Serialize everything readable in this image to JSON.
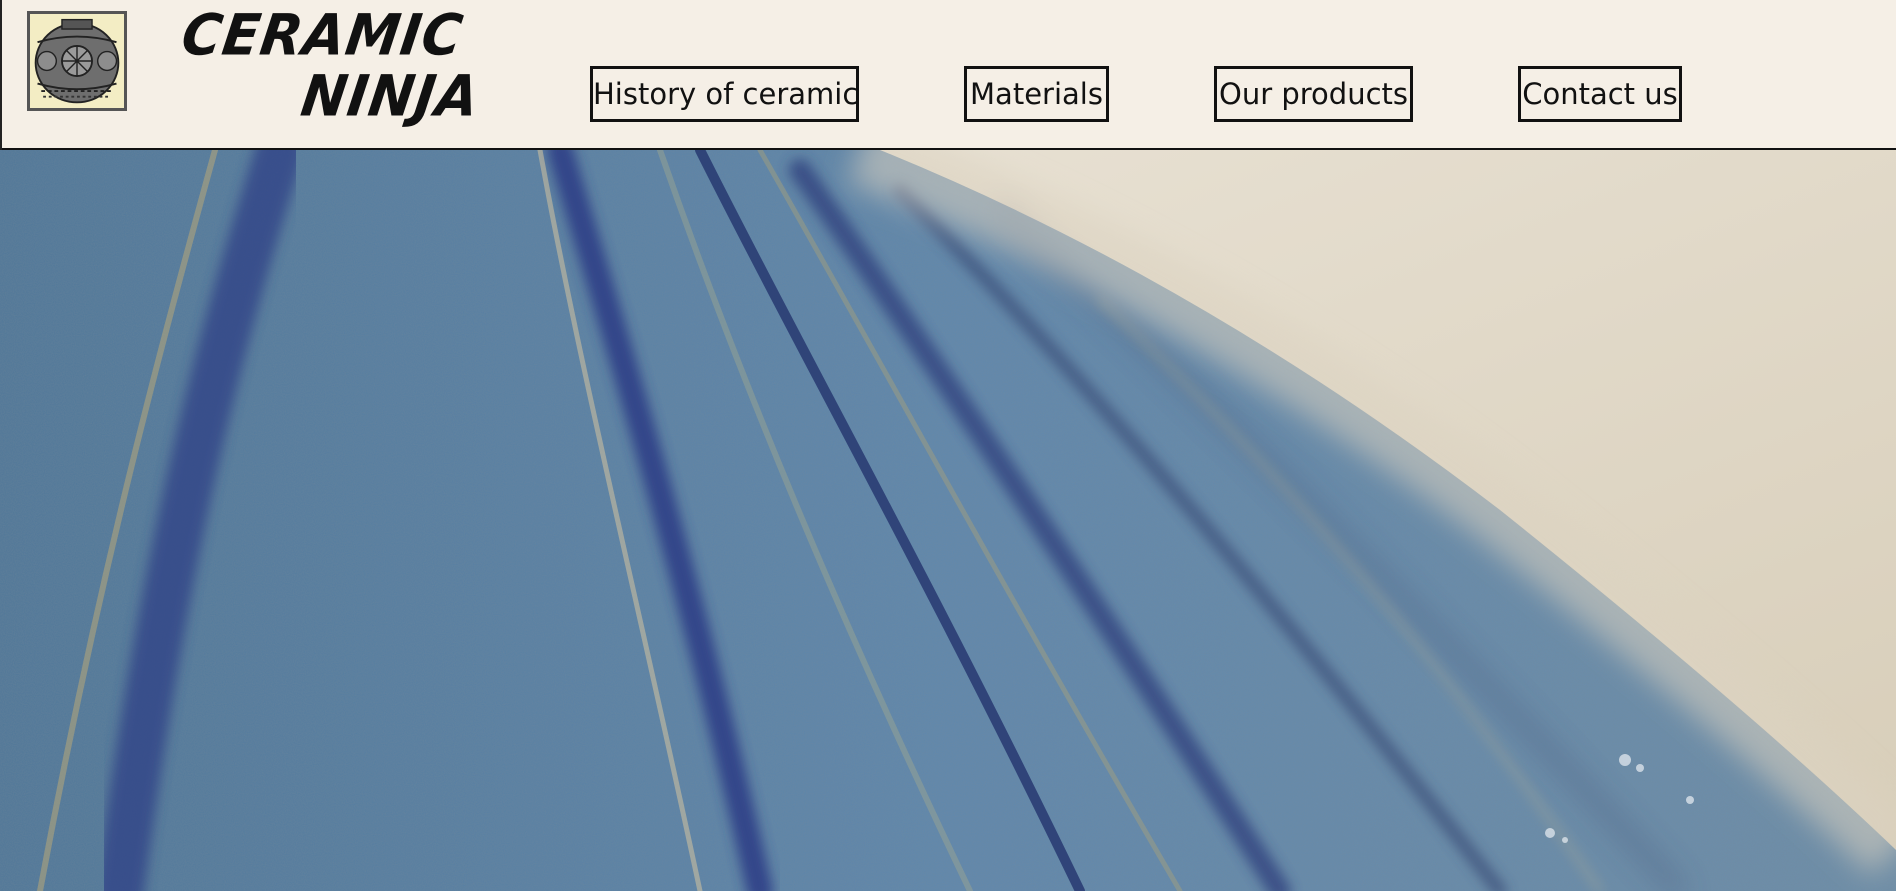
{
  "brand": {
    "line1": "CERAMIC",
    "line2": "NINJA",
    "logo_icon": "ceramic-vase-icon"
  },
  "nav": {
    "items": [
      {
        "label": "History of ceramic"
      },
      {
        "label": "Materials"
      },
      {
        "label": "Our products"
      },
      {
        "label": "Contact us"
      }
    ]
  },
  "hero": {
    "image": "blue-glazed-ceramic-closeup",
    "colors": {
      "glaze": "#5a7ea3",
      "glaze_dark": "#2d3f86",
      "background": "#ddd4c4"
    }
  },
  "colors": {
    "header_bg": "#f5efe6",
    "border": "#111111"
  }
}
